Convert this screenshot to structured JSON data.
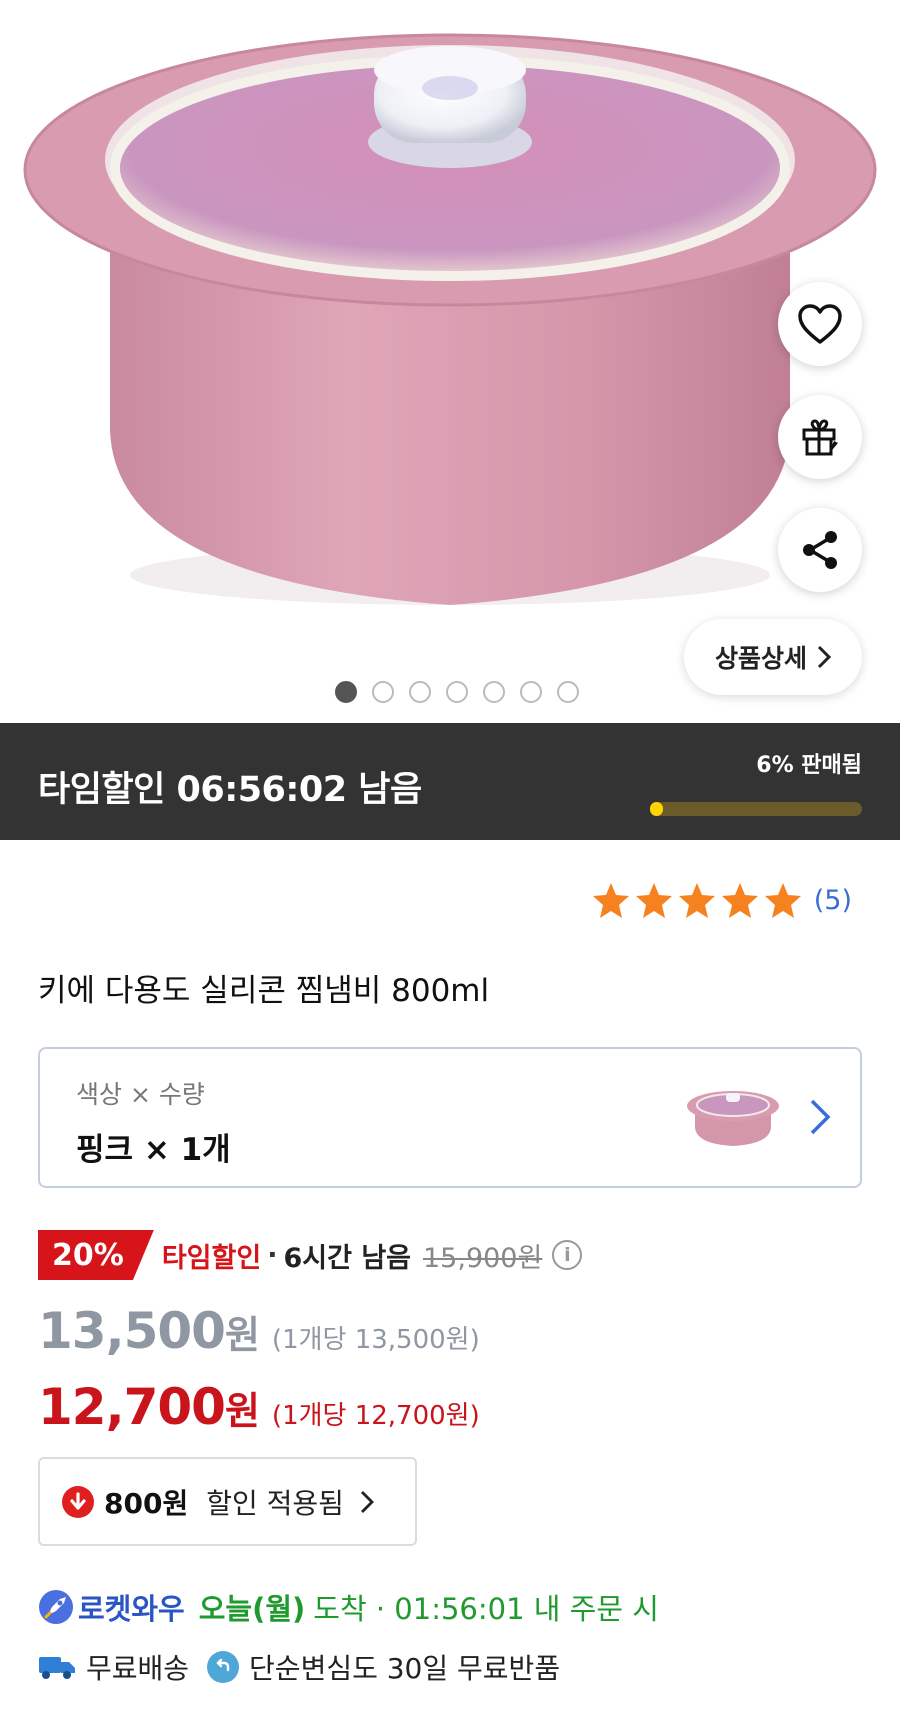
{
  "carousel": {
    "detail_button": "상품상세",
    "page_count": 7,
    "active_index": 0
  },
  "timer": {
    "title": "타임할인 06:56:02 남음",
    "sold_label": "6% 판매됨",
    "sold_fraction": 0.06
  },
  "rating": {
    "stars": 5,
    "count_text": "(5)",
    "star_color": "#f5821f"
  },
  "product": {
    "title": "키에 다용도 실리콘 찜냄비 800ml"
  },
  "option": {
    "label": "색상 × 수량",
    "value": "핑크 × 1개"
  },
  "discount": {
    "badge": "20%",
    "type": "타임할인",
    "separator": "·",
    "remaining": "6시간 남음",
    "original_price": "15,900원",
    "info_icon": "i"
  },
  "price_regular": {
    "amount": "13,500",
    "unit": "원",
    "per_unit": "(1개당 13,500원)"
  },
  "price_sale": {
    "amount": "12,700",
    "unit": "원",
    "per_unit": "(1개당 12,700원)"
  },
  "coupon": {
    "amount": "800원",
    "text": "할인 적용됨"
  },
  "delivery": {
    "brand": "로켓와우",
    "day": "오늘(월)",
    "rest": "도착 · 01:56:01 내 주문 시"
  },
  "shipping": {
    "free_shipping": "무료배송",
    "returns": "단순변심도 30일 무료반품"
  },
  "colors": {
    "accent_red": "#d7141a",
    "timebar_bg": "#333333",
    "rocket_blue": "#2b55c4",
    "arrival_green": "#1f9a2e"
  }
}
